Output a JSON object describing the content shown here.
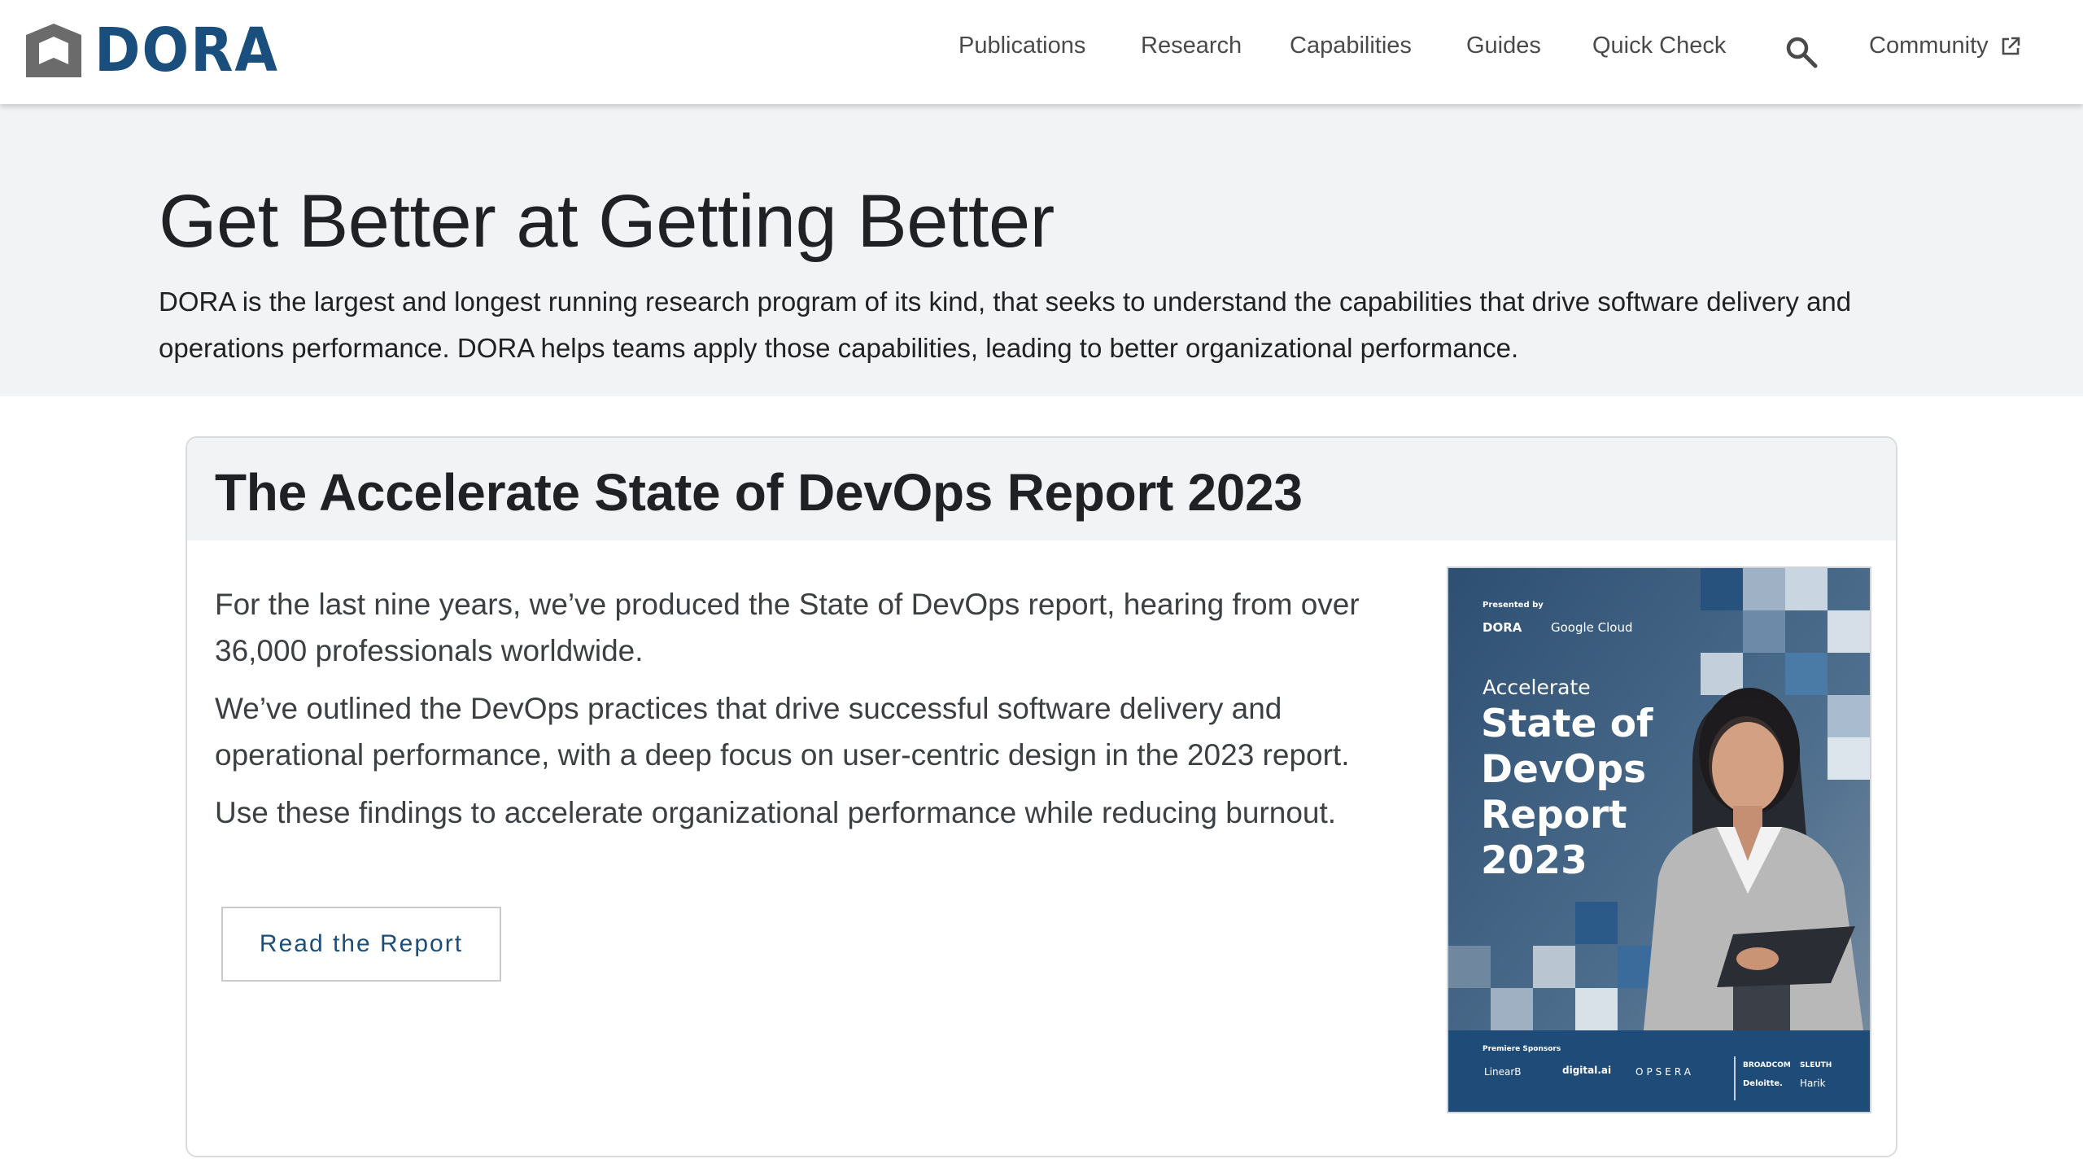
{
  "header": {
    "logo_text": "DORA",
    "nav": [
      {
        "label": "Publications"
      },
      {
        "label": "Research"
      },
      {
        "label": "Capabilities"
      },
      {
        "label": "Guides"
      },
      {
        "label": "Quick Check"
      }
    ],
    "community_label": "Community"
  },
  "hero": {
    "title": "Get Better at Getting Better",
    "description": "DORA is the largest and longest running research program of its kind, that seeks to understand the capabilities that drive software delivery and operations performance. DORA helps teams apply those capabilities, leading to better organizational performance."
  },
  "report_card": {
    "title": "The Accelerate State of DevOps Report 2023",
    "paragraphs": [
      "For the last nine years, we’ve produced the State of DevOps report, hearing from over 36,000 professionals worldwide.",
      "We’ve outlined the DevOps practices that drive successful software delivery and operational performance, with a deep focus on user-centric design in the 2023 report.",
      "Use these findings to accelerate organizational performance while reducing burnout."
    ],
    "button_label": "Read the Report",
    "cover": {
      "presented_by": "Presented by",
      "brand_dora": "DORA",
      "brand_google": "Google Cloud",
      "kicker": "Accelerate",
      "title_lines": [
        "State of",
        "DevOps",
        "Report",
        "2023"
      ],
      "sponsors_label": "Premiere Sponsors",
      "sponsors": [
        "LinearB",
        "digital.ai",
        "OPSERA",
        "BROADCOM",
        "SLEUTH",
        "Deloitte.",
        "Harik"
      ]
    }
  },
  "colors": {
    "brand_blue": "#1a4f7d",
    "hero_bg": "#f1f3f4",
    "logo_gray": "#6b6b6b"
  }
}
